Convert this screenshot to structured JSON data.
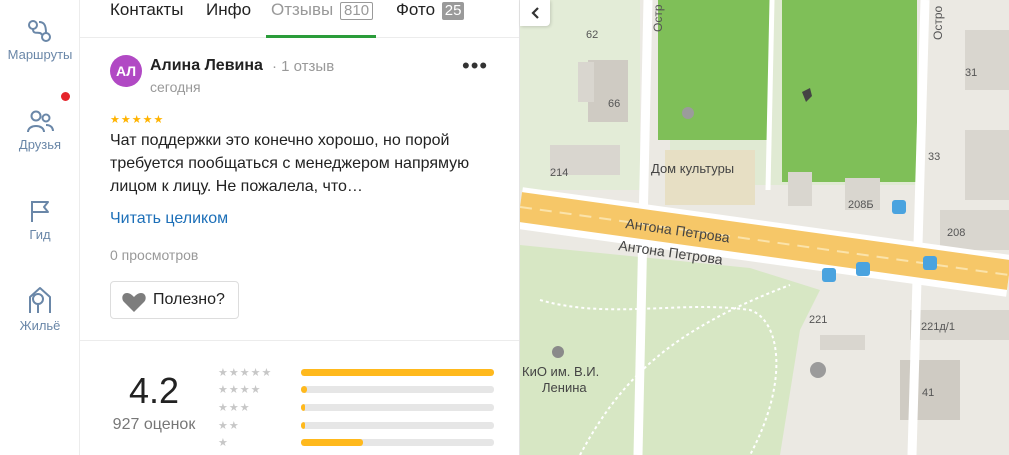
{
  "sidebar": {
    "items": [
      {
        "label": "Маршруты",
        "icon": "routes-icon"
      },
      {
        "label": "Друзья",
        "icon": "friends-icon",
        "has_notification": true
      },
      {
        "label": "Гид",
        "icon": "flag-icon"
      },
      {
        "label": "Жильё",
        "icon": "house-icon"
      }
    ]
  },
  "tabs": [
    {
      "label": "Контакты"
    },
    {
      "label": "Инфо"
    },
    {
      "label": "Отзывы",
      "count": "810",
      "active": true
    },
    {
      "label": "Фото",
      "count": "25"
    }
  ],
  "review": {
    "avatar_initials": "АЛ",
    "avatar_color": "#b149c4",
    "author": "Алина Левина",
    "author_reviews": "· 1 отзыв",
    "date": "сегодня",
    "stars": "★★★★★",
    "text": "Чат поддержки это конечно хорошо, но порой требуется пообщаться с менеджером напрямую лицом к лицу. Не пожалела, что…",
    "read_more": "Читать целиком",
    "views": "0 просмотров",
    "useful_label": "Полезно?",
    "menu_label": "•••"
  },
  "summary": {
    "rating": "4.2",
    "count_label": "927 оценок",
    "distribution": [
      {
        "stars": "★★★★★",
        "fraction": 1.0
      },
      {
        "stars": "★★★★",
        "fraction": 0.03
      },
      {
        "stars": "★★★",
        "fraction": 0.02
      },
      {
        "stars": "★★",
        "fraction": 0.02
      },
      {
        "stars": "★",
        "fraction": 0.32
      }
    ]
  },
  "map": {
    "labels": {
      "street_main_1": "Антона Петрова",
      "street_main_2": "Антона Петрова",
      "street_side_1": "Остр",
      "street_side_2": "Остро",
      "poi_culture": "Дом культуры",
      "poi_park_1": "КиО им. В.И.",
      "poi_park_2": "Ленина",
      "b_62": "62",
      "b_66": "66",
      "b_214": "214",
      "b_208b": "208Б",
      "b_208": "208",
      "b_31": "31",
      "b_33": "33",
      "b_221": "221",
      "b_221d1": "221д/1",
      "b_41": "41"
    },
    "colors": {
      "park": "#d7e7c4",
      "stadium": "#7fbf58",
      "road": "#f6c768",
      "building": "#d9d6cf",
      "background": "#ebe9e3"
    }
  },
  "colors": {
    "accent_green": "#2a9c3a",
    "link_blue": "#1c6fb8",
    "star_yellow": "#ffb300",
    "notification_red": "#e5242b"
  }
}
